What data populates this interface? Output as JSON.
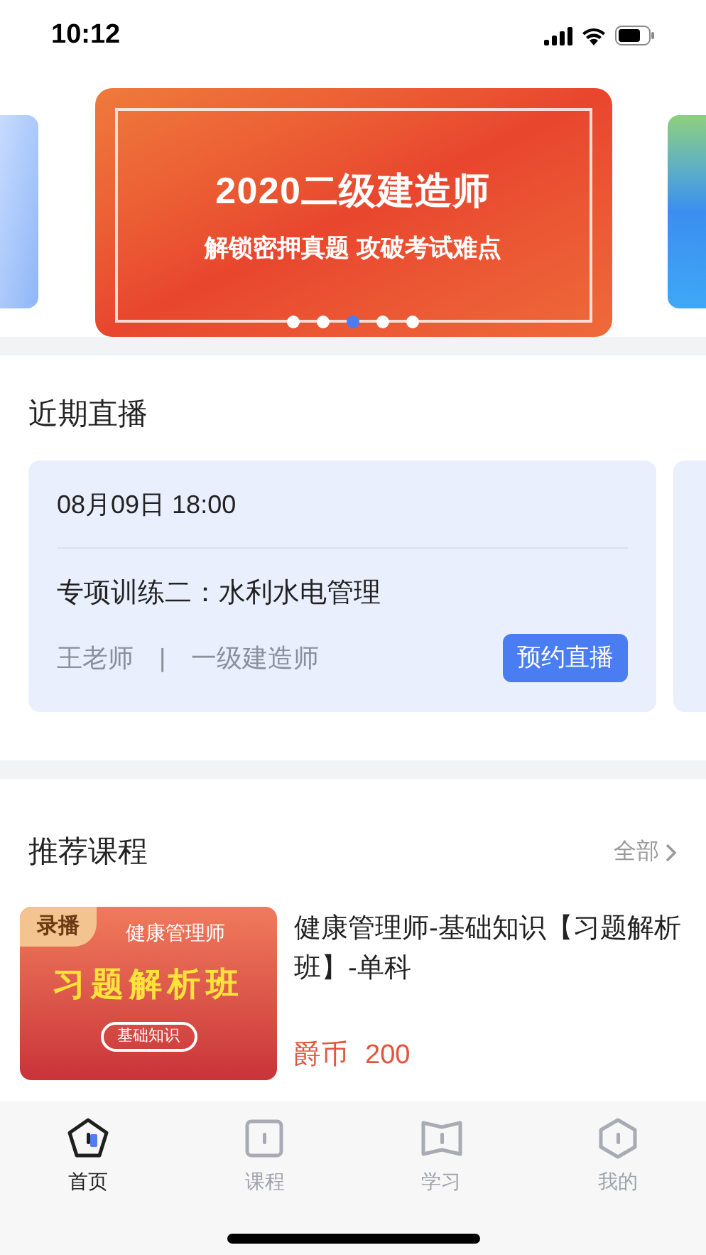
{
  "status_bar": {
    "time": "10:12"
  },
  "banner": {
    "title": "2020二级建造师",
    "subtitle": "解锁密押真题 攻破考试难点",
    "dots": [
      {
        "selected": false
      },
      {
        "selected": false
      },
      {
        "selected": true
      },
      {
        "selected": false
      },
      {
        "selected": false
      }
    ]
  },
  "live": {
    "heading": "近期直播",
    "card": {
      "datetime": "08月09日 18:00",
      "title": "专项训练二：水利水电管理",
      "teacher": "王老师",
      "separator": "|",
      "category": "一级建造师",
      "button": "预约直播"
    }
  },
  "courses": {
    "heading": "推荐课程",
    "more": "全部",
    "items": [
      {
        "badge": "录播",
        "thumb_top": "健康管理师",
        "thumb_title": "习题解析班",
        "thumb_tag": "基础知识",
        "title": "健康管理师-基础知识【习题解析班】-单科",
        "price_label": "爵币",
        "price": "200"
      }
    ]
  },
  "tab_bar": [
    {
      "label": "首页",
      "kind": "pentagon",
      "selected": true
    },
    {
      "label": "课程",
      "kind": "square",
      "selected": false
    },
    {
      "label": "学习",
      "kind": "book",
      "selected": false
    },
    {
      "label": "我的",
      "kind": "hexagon",
      "selected": false
    }
  ]
}
